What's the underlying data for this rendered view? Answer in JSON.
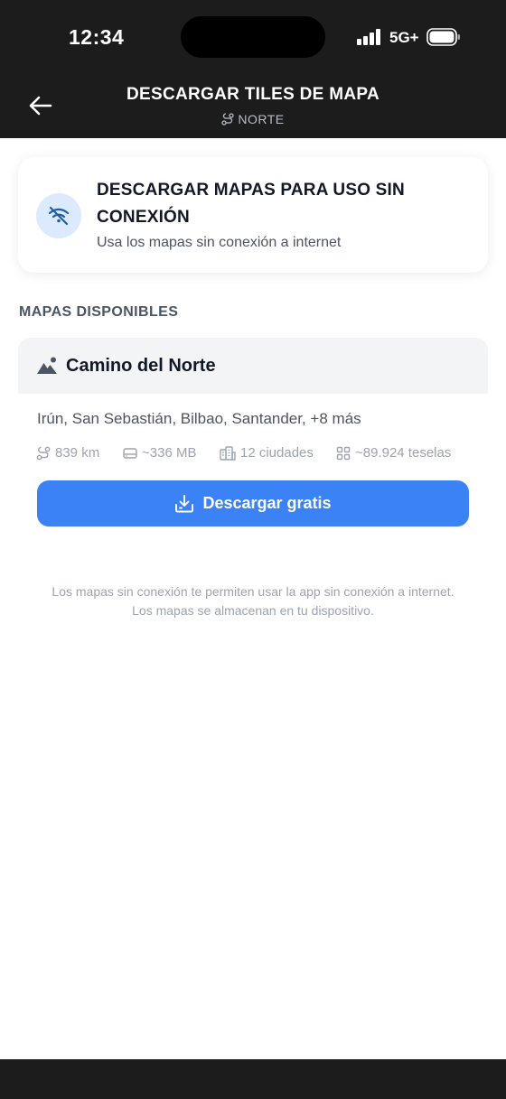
{
  "status_bar": {
    "time": "12:34",
    "network": "5G+",
    "icons": [
      "signal-icon",
      "battery-icon"
    ]
  },
  "header": {
    "title": "DESCARGAR TILES DE MAPA",
    "subtitle": "NORTE",
    "back_icon": "arrow-left-icon",
    "subtitle_icon": "route-icon"
  },
  "offline_card": {
    "icon": "wifi-off-icon",
    "title": "DESCARGAR MAPAS PARA USO SIN CONEXIÓN",
    "subtitle": "Usa los mapas sin conexión a internet"
  },
  "section": {
    "title": "MAPAS DISPONIBLES"
  },
  "route": {
    "icon": "mountain-icon",
    "name": "Camino del Norte",
    "cities": "Irún, San Sebastián, Bilbao, Santander, +8 más",
    "stats": {
      "distance": "839 km",
      "size": "~336 MB",
      "cities": "12 ciudades",
      "tiles": "~89.924 teselas"
    },
    "download_label": "Descargar gratis",
    "download_icon": "download-icon"
  },
  "footer": {
    "line1": "Los mapas sin conexión te permiten usar la app sin conexión a internet.",
    "line2": "Los mapas se almacenan en tu dispositivo."
  },
  "colors": {
    "header_bg": "#1c1c1c",
    "accent": "#3b82f6",
    "icon_circle": "#dbeafe"
  }
}
